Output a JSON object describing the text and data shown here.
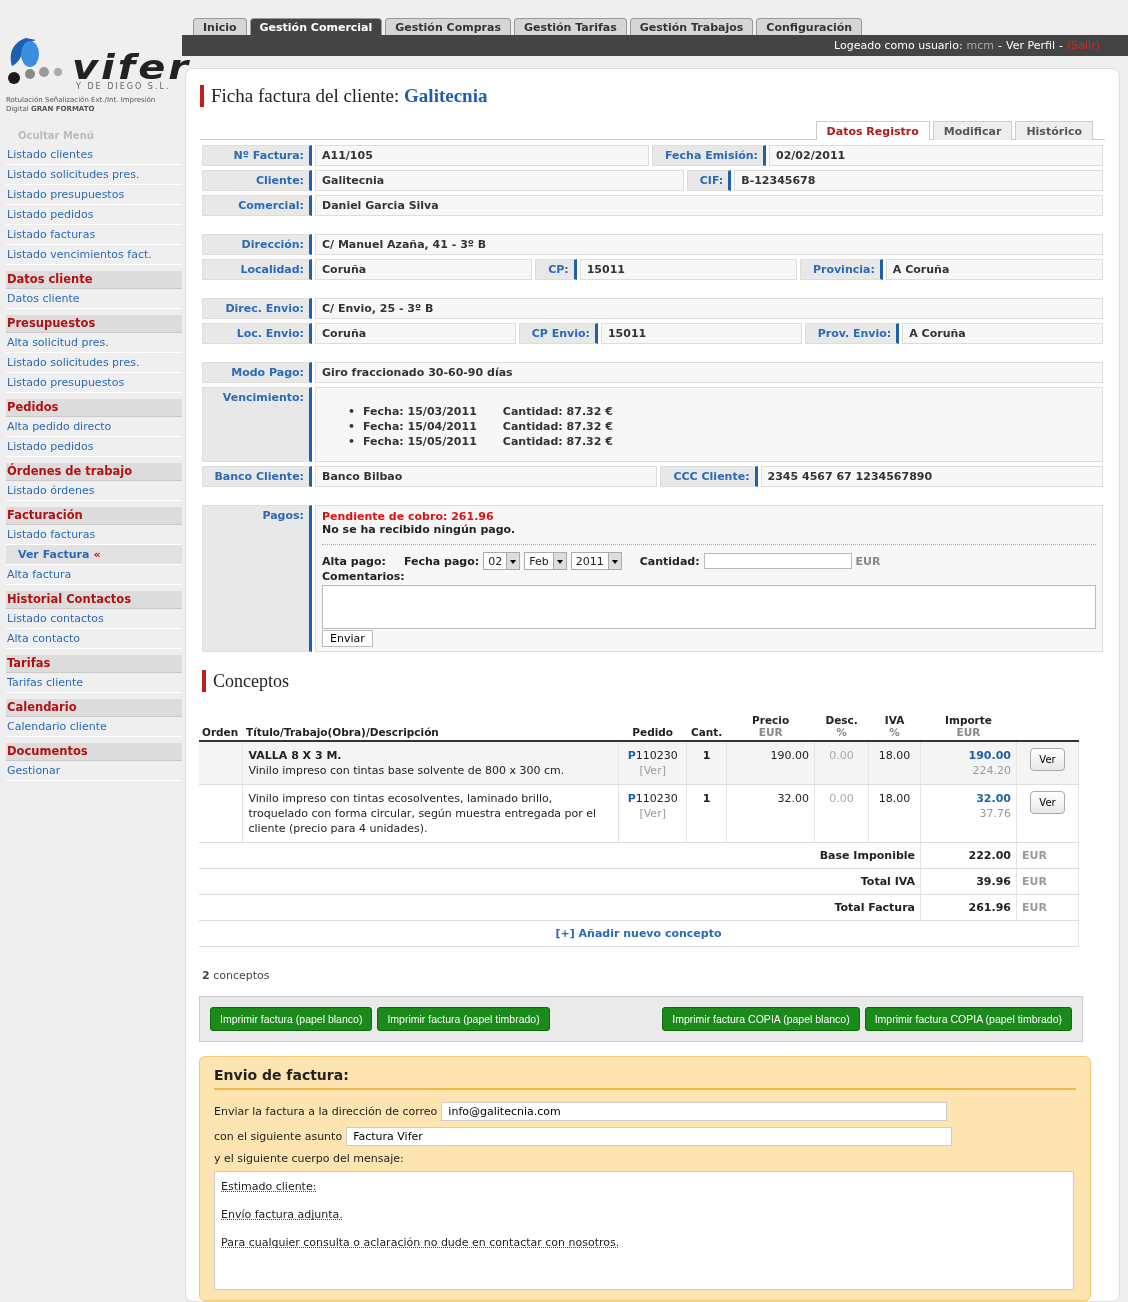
{
  "sidebar": {
    "logo": {
      "wordmark": "vifer",
      "company": "Y DE DIEGO S.L.",
      "slogan": "Rotulación Señalización Ext./Int. Impresión Digital **GRAN FORMATO**"
    },
    "toggle": "Ocultar Menú",
    "links": [
      {
        "label": "Listado clientes",
        "selected": false
      },
      {
        "label": "Listado solicitudes pres.",
        "selected": false
      },
      {
        "label": "Listado presupuestos",
        "selected": false
      },
      {
        "label": "Listado pedidos",
        "selected": false
      },
      {
        "label": "Listado facturas",
        "selected": false
      },
      {
        "label": "Listado vencimientos fact.",
        "selected": false
      }
    ],
    "sections": [
      {
        "heading": "Datos cliente",
        "items": [
          {
            "label": "Datos cliente",
            "selected": false
          }
        ]
      },
      {
        "heading": "Presupuestos",
        "items": [
          {
            "label": "Alta solicitud pres.",
            "selected": false
          },
          {
            "label": "Listado solicitudes pres.",
            "selected": false
          },
          {
            "label": "Listado presupuestos",
            "selected": false
          }
        ]
      },
      {
        "heading": "Pedidos",
        "items": [
          {
            "label": "Alta pedido directo",
            "selected": false
          },
          {
            "label": "Listado pedidos",
            "selected": false
          }
        ]
      },
      {
        "heading": "Órdenes de trabajo",
        "items": [
          {
            "label": "Listado órdenes",
            "selected": false
          }
        ]
      },
      {
        "heading": "Facturación",
        "items": [
          {
            "label": "Listado facturas",
            "selected": false
          },
          {
            "label": "Ver Factura",
            "selected": true,
            "marker": "«"
          },
          {
            "label": "Alta factura",
            "selected": false
          }
        ]
      },
      {
        "heading": "Historial Contactos",
        "items": [
          {
            "label": "Listado contactos",
            "selected": false
          },
          {
            "label": "Alta contacto",
            "selected": false
          }
        ]
      },
      {
        "heading": "Tarifas",
        "items": [
          {
            "label": "Tarifas cliente",
            "selected": false
          }
        ]
      },
      {
        "heading": "Calendario",
        "items": [
          {
            "label": "Calendario cliente",
            "selected": false
          }
        ]
      },
      {
        "heading": "Documentos",
        "items": [
          {
            "label": "Gestionar",
            "selected": false
          }
        ]
      }
    ]
  },
  "main_tabs": [
    {
      "label": "Inicio",
      "selected": false
    },
    {
      "label": "Gestión Comercial",
      "selected": true
    },
    {
      "label": "Gestión Compras",
      "selected": false
    },
    {
      "label": "Gestión Tarifas",
      "selected": false
    },
    {
      "label": "Gestión Trabajos",
      "selected": false
    },
    {
      "label": "Configuración",
      "selected": false
    }
  ],
  "user_bar": [
    {
      "kind": "label",
      "text": "Logeado como usuario:"
    },
    {
      "kind": "user",
      "text": "mcm"
    },
    {
      "kind": "sep",
      "text": "-"
    },
    {
      "kind": "link",
      "text": "Ver Perfil"
    },
    {
      "kind": "sep",
      "text": "-"
    },
    {
      "kind": "logout",
      "text": "(Salir)"
    }
  ],
  "page": {
    "title": "Ficha factura del cliente: **Galitecnia**",
    "tabs": [
      {
        "label": "Datos Registro",
        "selected": true
      },
      {
        "label": "Modificar",
        "selected": false
      },
      {
        "label": "Histórico",
        "selected": false
      }
    ],
    "groups": [
      [
        {
          "kind": "fields",
          "fields": [
            {
              "label": "Nº Factura:",
              "value": "A11/105"
            },
            {
              "label": "Fecha Emisión:",
              "value": "02/02/2011"
            }
          ]
        },
        {
          "kind": "fields",
          "fields": [
            {
              "label": "Cliente:",
              "value": "Galitecnia"
            },
            {
              "label": "CIF:",
              "value": "B-12345678"
            }
          ]
        },
        {
          "kind": "fields",
          "fields": [
            {
              "label": "Comercial:",
              "value": "Daniel Garcia Silva"
            }
          ]
        }
      ],
      [
        {
          "kind": "fields",
          "fields": [
            {
              "label": "Dirección:",
              "value": "C/ Manuel Azaña, 41 - 3º B"
            }
          ]
        },
        {
          "kind": "fields",
          "fields": [
            {
              "label": "Localidad:",
              "value": "Coruña"
            },
            {
              "label": "CP:",
              "value": "15011"
            },
            {
              "label": "Provincia:",
              "value": "A Coruña"
            }
          ]
        }
      ],
      [
        {
          "kind": "fields",
          "fields": [
            {
              "label": "Direc. Envio:",
              "value": "C/ Envio, 25 - 3º B"
            }
          ]
        },
        {
          "kind": "fields",
          "fields": [
            {
              "label": "Loc. Envio:",
              "value": "Coruña"
            },
            {
              "label": "CP Envio:",
              "value": "15011"
            },
            {
              "label": "Prov. Envio:",
              "value": "A Coruña"
            }
          ]
        }
      ],
      [
        {
          "kind": "fields",
          "fields": [
            {
              "label": "Modo Pago:",
              "value": "Giro fraccionado 30-60-90 días"
            }
          ]
        },
        {
          "kind": "vencimiento",
          "label": "Vencimiento:",
          "entries": [
            {
              "bullet": "•",
              "fecha": "Fecha: 15/03/2011",
              "cantidad": "Cantidad: 87.32 €"
            },
            {
              "bullet": "•",
              "fecha": "Fecha: 15/04/2011",
              "cantidad": "Cantidad: 87.32 €"
            },
            {
              "bullet": "•",
              "fecha": "Fecha: 15/05/2011",
              "cantidad": "Cantidad: 87.32 €"
            }
          ]
        },
        {
          "kind": "fields",
          "fields": [
            {
              "label": "Banco Cliente:",
              "value": "Banco Bilbao"
            },
            {
              "label": "CCC Cliente:",
              "value": "2345 4567 67 1234567890"
            }
          ]
        }
      ],
      [
        {
          "kind": "pagos",
          "label": "Pagos:",
          "pending": "Pendiente de cobro: 261.96",
          "status": "No se ha recibido ningún pago.",
          "alta_label": "Alta pago:",
          "date_label": "Fecha pago:",
          "day": "02",
          "month": "Feb",
          "year": "2011",
          "amount_label": "Cantidad:",
          "currency": "EUR",
          "comments_label": "Comentarios:",
          "submit": "Enviar"
        }
      ]
    ],
    "conceptos": {
      "title": "Conceptos",
      "columns": [
        {
          "label": "Orden"
        },
        {
          "label": "Título/Trabajo(Obra)/Descripción"
        },
        {
          "label": "Pedido"
        },
        {
          "label": "Cant."
        },
        {
          "label": "Precio",
          "unit": "EUR"
        },
        {
          "label": "Desc.",
          "unit": "%"
        },
        {
          "label": "IVA",
          "unit": "%"
        },
        {
          "label": "Importe",
          "unit": "EUR"
        }
      ],
      "rows": [
        {
          "title": "VALLA 8 X 3 M.",
          "description": "Vinilo impreso con tintas base solvente de 800 x 300 cm.",
          "pedido": "**P**110230",
          "pedido_link": "[Ver]",
          "cant": "1",
          "precio": "190.00",
          "desc": "0.00",
          "iva": "18.00",
          "importe": "190.00",
          "importe_total": "224.20",
          "button": "Ver"
        },
        {
          "description": "Vinilo impreso con tintas ecosolventes, laminado brillo, troquelado con forma circular, según muestra entregada por el cliente (precio para 4 unidades).",
          "pedido": "**P**110230",
          "pedido_link": "[Ver]",
          "cant": "1",
          "precio": "32.00",
          "desc": "0.00",
          "iva": "18.00",
          "importe": "32.00",
          "importe_total": "37.76",
          "button": "Ver"
        }
      ],
      "totals": [
        {
          "label": "Base Imponible",
          "value": "222.00",
          "unit": "EUR"
        },
        {
          "label": "Total IVA",
          "value": "39.96",
          "unit": "EUR"
        },
        {
          "label": "Total Factura",
          "value": "261.96",
          "unit": "EUR"
        }
      ],
      "add_link": "[+] Añadir nuevo concepto",
      "count": "**2** conceptos"
    },
    "print_buttons": {
      "left": [
        "Imprimir factura (papel blanco)",
        "Imprimir factura (papel timbrado)"
      ],
      "right": [
        "Imprimir factura COPIA (papel blanco)",
        "Imprimir factura COPIA (papel timbrado)"
      ]
    },
    "envio": {
      "title": "Envio de factura:",
      "email_label": "Enviar la factura a la dirección de correo",
      "email": "info@galitecnia.com",
      "subject_label": "con el siguiente asunto",
      "subject": "Factura Vifer",
      "body_label": "y el siguiente cuerpo del mensaje:",
      "body": [
        "Estimado cliente:",
        "Envío factura adjunta.",
        "Para cualquier consulta o aclaración no dude en contactar con nosotros."
      ]
    }
  }
}
